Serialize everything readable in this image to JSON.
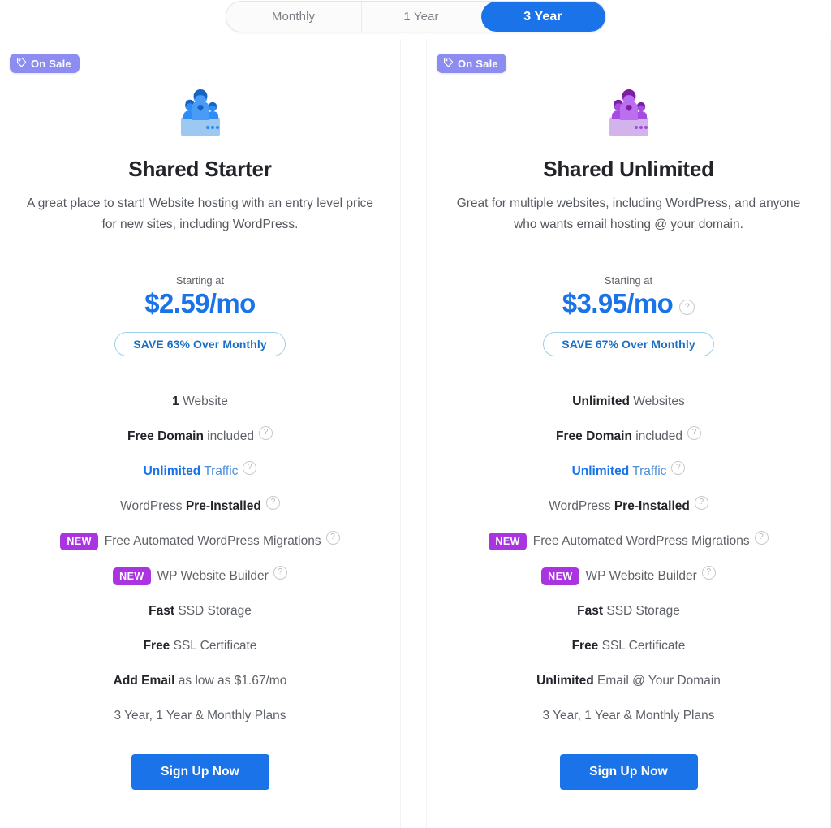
{
  "term_toggle": {
    "options": [
      {
        "label": "Monthly",
        "active": false
      },
      {
        "label": "1 Year",
        "active": false
      },
      {
        "label": "3 Year",
        "active": true
      }
    ]
  },
  "badges": {
    "on_sale": "On Sale",
    "new": "NEW"
  },
  "colors": {
    "accent_blue": "#1a73e8",
    "on_sale_purple": "#8d8cf0",
    "new_purple": "#a934e0",
    "icon_blue": "#2d8cf5",
    "icon_purple": "#a64ce0",
    "save_pill_border": "#9fd0ea",
    "save_pill_text": "#1a6fc4"
  },
  "plans": [
    {
      "on_sale": "On Sale",
      "icon": "people-group-icon",
      "icon_theme": "blue",
      "name": "Shared Starter",
      "description": "A great place to start! Website hosting with an entry level price for new sites, including WordPress.",
      "starting_at": "Starting at",
      "price": "$2.59/mo",
      "price_has_help": false,
      "save_label": "SAVE 63% Over Monthly",
      "features": [
        {
          "parts": [
            {
              "t": "1",
              "s": "bold"
            },
            {
              "t": " Website",
              "s": "normal"
            }
          ],
          "help": false,
          "new": false
        },
        {
          "parts": [
            {
              "t": "Free Domain",
              "s": "bold"
            },
            {
              "t": " included",
              "s": "normal"
            }
          ],
          "help": true,
          "new": false
        },
        {
          "parts": [
            {
              "t": "Unlimited",
              "s": "blue"
            },
            {
              "t": " Traffic",
              "s": "blue-light"
            }
          ],
          "help": true,
          "new": false
        },
        {
          "parts": [
            {
              "t": "WordPress ",
              "s": "normal"
            },
            {
              "t": "Pre-Installed",
              "s": "bold"
            }
          ],
          "help": true,
          "new": false
        },
        {
          "parts": [
            {
              "t": "Free Automated WordPress Migrations",
              "s": "normal"
            }
          ],
          "help": true,
          "new": true
        },
        {
          "parts": [
            {
              "t": "WP Website Builder",
              "s": "normal"
            }
          ],
          "help": true,
          "new": true
        },
        {
          "parts": [
            {
              "t": "Fast",
              "s": "bold"
            },
            {
              "t": " SSD Storage",
              "s": "normal"
            }
          ],
          "help": false,
          "new": false
        },
        {
          "parts": [
            {
              "t": "Free",
              "s": "bold"
            },
            {
              "t": " SSL Certificate",
              "s": "normal"
            }
          ],
          "help": false,
          "new": false
        },
        {
          "parts": [
            {
              "t": "Add Email",
              "s": "bold"
            },
            {
              "t": " as low as $1.67/mo",
              "s": "normal"
            }
          ],
          "help": false,
          "new": false
        },
        {
          "parts": [
            {
              "t": "3 Year, 1 Year & Monthly Plans",
              "s": "normal"
            }
          ],
          "help": false,
          "new": false
        }
      ],
      "cta": "Sign Up Now"
    },
    {
      "on_sale": "On Sale",
      "icon": "people-group-icon",
      "icon_theme": "purple",
      "name": "Shared Unlimited",
      "description": "Great for multiple websites, including WordPress, and anyone who wants email hosting @ your domain.",
      "starting_at": "Starting at",
      "price": "$3.95/mo",
      "price_has_help": true,
      "save_label": "SAVE 67% Over Monthly",
      "features": [
        {
          "parts": [
            {
              "t": "Unlimited",
              "s": "bold"
            },
            {
              "t": " Websites",
              "s": "normal"
            }
          ],
          "help": false,
          "new": false
        },
        {
          "parts": [
            {
              "t": "Free Domain",
              "s": "bold"
            },
            {
              "t": " included",
              "s": "normal"
            }
          ],
          "help": true,
          "new": false
        },
        {
          "parts": [
            {
              "t": "Unlimited",
              "s": "blue"
            },
            {
              "t": " Traffic",
              "s": "blue-light"
            }
          ],
          "help": true,
          "new": false
        },
        {
          "parts": [
            {
              "t": "WordPress ",
              "s": "normal"
            },
            {
              "t": "Pre-Installed",
              "s": "bold"
            }
          ],
          "help": true,
          "new": false
        },
        {
          "parts": [
            {
              "t": "Free Automated WordPress Migrations",
              "s": "normal"
            }
          ],
          "help": true,
          "new": true
        },
        {
          "parts": [
            {
              "t": "WP Website Builder",
              "s": "normal"
            }
          ],
          "help": true,
          "new": true
        },
        {
          "parts": [
            {
              "t": "Fast",
              "s": "bold"
            },
            {
              "t": " SSD Storage",
              "s": "normal"
            }
          ],
          "help": false,
          "new": false
        },
        {
          "parts": [
            {
              "t": "Free",
              "s": "bold"
            },
            {
              "t": " SSL Certificate",
              "s": "normal"
            }
          ],
          "help": false,
          "new": false
        },
        {
          "parts": [
            {
              "t": "Unlimited",
              "s": "bold"
            },
            {
              "t": " Email @ Your Domain",
              "s": "normal"
            }
          ],
          "help": false,
          "new": false
        },
        {
          "parts": [
            {
              "t": "3 Year, 1 Year & Monthly Plans",
              "s": "normal"
            }
          ],
          "help": false,
          "new": false
        }
      ],
      "cta": "Sign Up Now"
    }
  ],
  "help_icon_glyph": "?"
}
